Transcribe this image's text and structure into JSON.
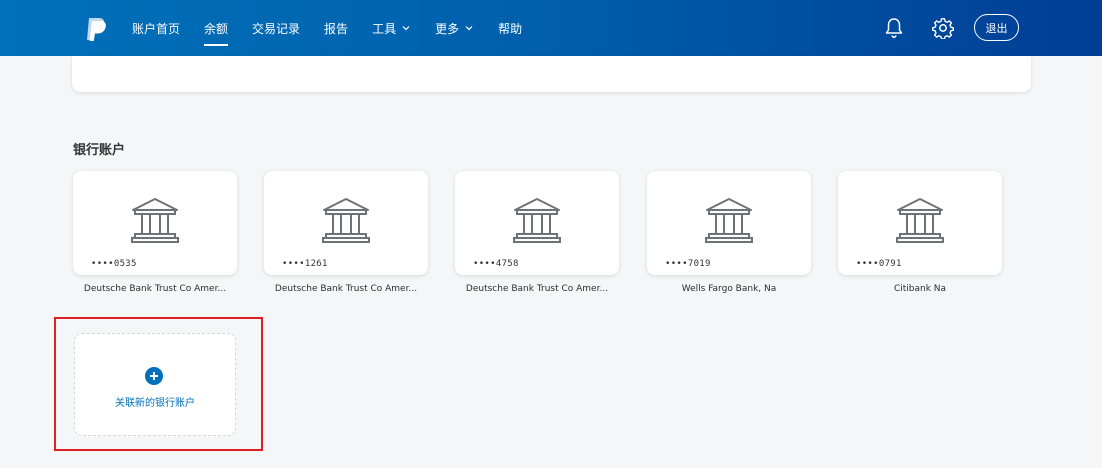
{
  "nav": {
    "logo": "paypal-logo-icon",
    "items": [
      {
        "label": "账户首页",
        "active": false,
        "dropdown": false
      },
      {
        "label": "余额",
        "active": true,
        "dropdown": false
      },
      {
        "label": "交易记录",
        "active": false,
        "dropdown": false
      },
      {
        "label": "报告",
        "active": false,
        "dropdown": false
      },
      {
        "label": "工具",
        "active": false,
        "dropdown": true
      },
      {
        "label": "更多",
        "active": false,
        "dropdown": true
      },
      {
        "label": "帮助",
        "active": false,
        "dropdown": false
      }
    ],
    "notification_icon": "bell-icon",
    "settings_icon": "gear-icon",
    "logout_label": "退出"
  },
  "bank_section": {
    "title": "银行账户",
    "accounts": [
      {
        "masked_number": "••••0535",
        "name": "Deutsche Bank Trust Co Amer..."
      },
      {
        "masked_number": "••••1261",
        "name": "Deutsche Bank Trust Co Amer..."
      },
      {
        "masked_number": "••••4758",
        "name": "Deutsche Bank Trust Co Amer..."
      },
      {
        "masked_number": "••••7019",
        "name": "Wells Fargo Bank, Na"
      },
      {
        "masked_number": "••••0791",
        "name": "Citibank Na"
      }
    ],
    "add_bank_label": "关联新的银行账户"
  },
  "colors": {
    "brand_blue": "#0070ba",
    "nav_dark": "#003e96",
    "highlight_red": "#e02020"
  }
}
